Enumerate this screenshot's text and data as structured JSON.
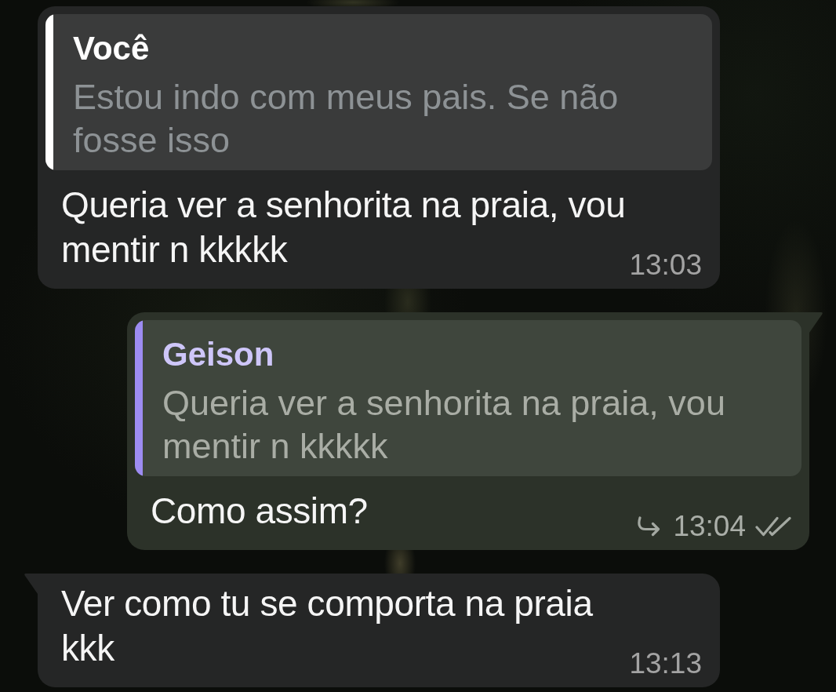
{
  "messages": [
    {
      "kind": "incoming",
      "tail": false,
      "reply": {
        "sender": "Você",
        "text": "Estou indo com meus pais. Se não fosse isso",
        "color": "#ffffff"
      },
      "text": "Queria ver a senhorita na praia, vou mentir n kkkkk",
      "hook_arrow": false,
      "time": "13:03"
    },
    {
      "kind": "outgoing",
      "tail": true,
      "reply": {
        "sender": "Geison",
        "text": "Queria ver a senhorita na praia, vou mentir n kkkkk",
        "color": "#9d8cf2"
      },
      "text": "Como assim?",
      "hook_arrow": true,
      "time": "13:04",
      "read": true
    },
    {
      "kind": "incoming",
      "tail": true,
      "text": "Ver como tu se comporta na praia kkk",
      "hook_arrow": false,
      "time": "13:13"
    }
  ]
}
